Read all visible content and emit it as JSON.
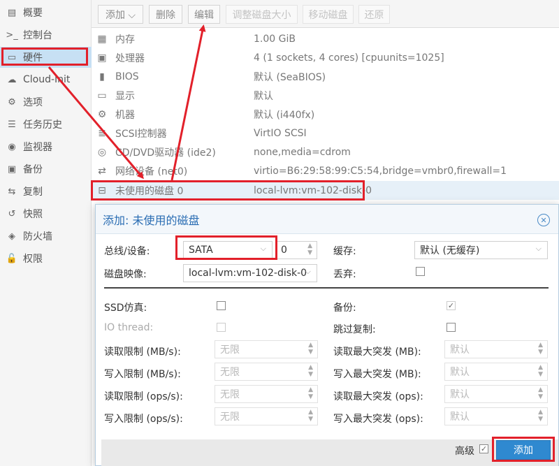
{
  "sidebar": {
    "items": [
      {
        "label": "概要",
        "icon": "book-icon",
        "glyph": "▤"
      },
      {
        "label": "控制台",
        "icon": "terminal-icon",
        "glyph": ">_"
      },
      {
        "label": "硬件",
        "icon": "monitor-icon",
        "glyph": "▭"
      },
      {
        "label": "Cloud-Init",
        "icon": "cloud-icon",
        "glyph": "☁"
      },
      {
        "label": "选项",
        "icon": "gear-icon",
        "glyph": "⚙"
      },
      {
        "label": "任务历史",
        "icon": "list-icon",
        "glyph": "☰"
      },
      {
        "label": "监视器",
        "icon": "eye-icon",
        "glyph": "◉"
      },
      {
        "label": "备份",
        "icon": "save-icon",
        "glyph": "▣"
      },
      {
        "label": "复制",
        "icon": "retweet-icon",
        "glyph": "⇆"
      },
      {
        "label": "快照",
        "icon": "history-icon",
        "glyph": "↺"
      },
      {
        "label": "防火墙",
        "icon": "shield-icon",
        "glyph": "◈"
      },
      {
        "label": "权限",
        "icon": "unlock-icon",
        "glyph": "🔓"
      }
    ]
  },
  "toolbar": {
    "add": "添加 ⌵",
    "remove": "删除",
    "edit": "编辑",
    "resize": "调整磁盘大小",
    "move": "移动磁盘",
    "revert": "还原"
  },
  "hardware": [
    {
      "name": "内存",
      "value": "1.00 GiB",
      "icon": "memory-icon",
      "glyph": "▦"
    },
    {
      "name": "处理器",
      "value": "4 (1 sockets, 4 cores) [cpuunits=1025]",
      "icon": "cpu-icon",
      "glyph": "▣"
    },
    {
      "name": "BIOS",
      "value": "默认 (SeaBIOS)",
      "icon": "chip-icon",
      "glyph": "▮"
    },
    {
      "name": "显示",
      "value": "默认",
      "icon": "desktop-icon",
      "glyph": "▭"
    },
    {
      "name": "机器",
      "value": "默认 (i440fx)",
      "icon": "cogs-icon",
      "glyph": "⚙"
    },
    {
      "name": "SCSI控制器",
      "value": "VirtIO SCSI",
      "icon": "database-icon",
      "glyph": "≣"
    },
    {
      "name": "CD/DVD驱动器 (ide2)",
      "value": "none,media=cdrom",
      "icon": "cdrom-icon",
      "glyph": "◎"
    },
    {
      "name": "网络设备 (net0)",
      "value": "virtio=B6:29:58:99:C5:54,bridge=vmbr0,firewall=1",
      "icon": "exchange-icon",
      "glyph": "⇄"
    },
    {
      "name": "未使用的磁盘 0",
      "value": "local-lvm:vm-102-disk-0",
      "icon": "hdd-icon",
      "glyph": "⊟"
    }
  ],
  "dialog": {
    "title": "添加: 未使用的磁盘",
    "bus_label": "总线/设备:",
    "bus_value": "SATA",
    "bus_index": "0",
    "image_label": "磁盘映像:",
    "image_value": "local-lvm:vm-102-disk-0",
    "cache_label": "缓存:",
    "cache_value": "默认 (无缓存)",
    "discard_label": "丢弃:",
    "ssd_label": "SSD仿真:",
    "iothread_label": "IO thread:",
    "backup_label": "备份:",
    "skip_repl_label": "跳过复制:",
    "read_mbs_label": "读取限制 (MB/s):",
    "write_mbs_label": "写入限制 (MB/s):",
    "read_ops_label": "读取限制 (ops/s):",
    "write_ops_label": "写入限制 (ops/s):",
    "read_burst_mb_label": "读取最大突发 (MB):",
    "write_burst_mb_label": "写入最大突发 (MB):",
    "read_burst_ops_label": "读取最大突发 (ops):",
    "write_burst_ops_label": "写入最大突发 (ops):",
    "unlimited": "无限",
    "default": "默认",
    "advanced_label": "高级",
    "add_button": "添加",
    "check": "✓"
  },
  "colors": {
    "annotation": "#e2202a",
    "accent": "#2f89d0"
  }
}
